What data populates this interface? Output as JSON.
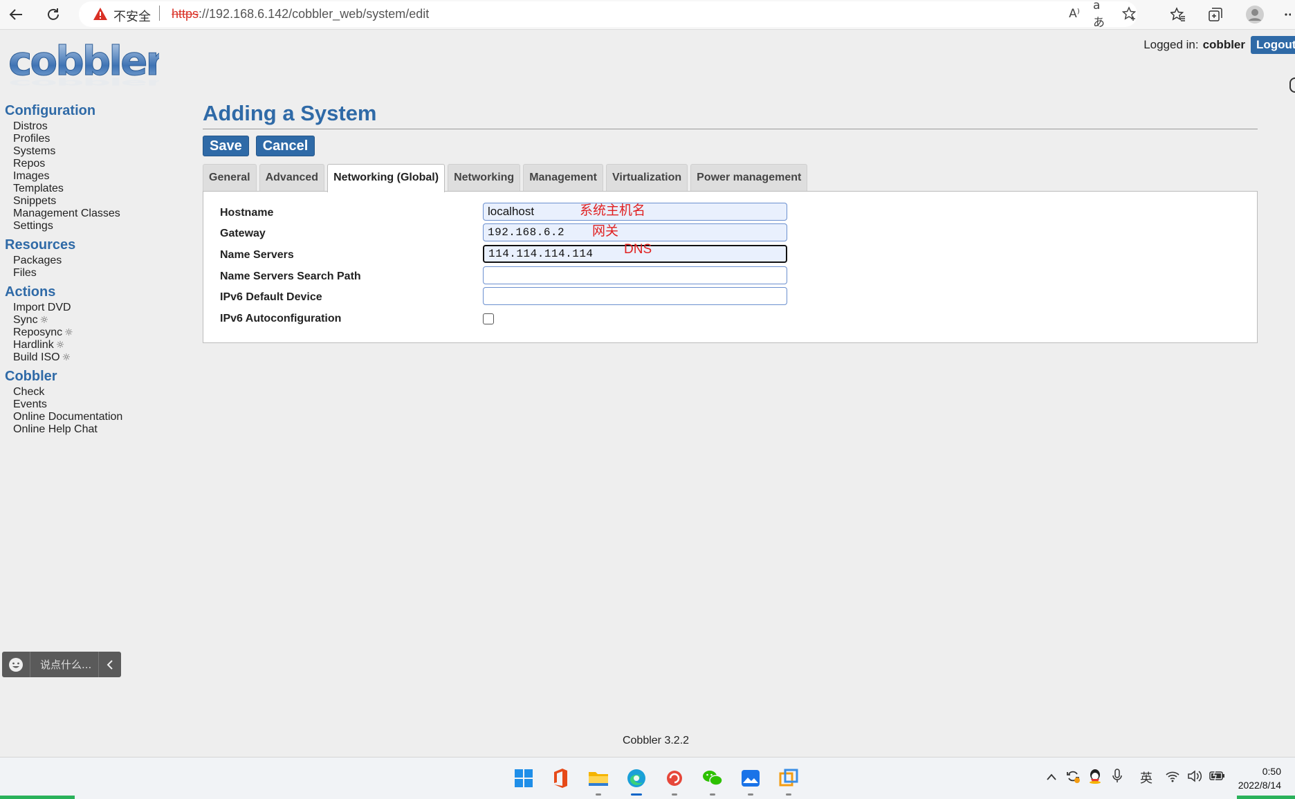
{
  "browser": {
    "security_label": "不安全",
    "url_scheme": "https",
    "url_rest": "://192.168.6.142/cobbler_web/system/edit",
    "read_aloud_icon": "A⁾",
    "translate_icon": "aあ"
  },
  "header": {
    "logo_alt": "cobbler",
    "login_label": "Logged in:",
    "login_user": "cobbler",
    "logout_label": "Logout"
  },
  "sidebar": {
    "sections": [
      {
        "title": "Configuration",
        "items": [
          "Distros",
          "Profiles",
          "Systems",
          "Repos",
          "Images",
          "Templates",
          "Snippets",
          "Management Classes",
          "Settings"
        ]
      },
      {
        "title": "Resources",
        "items": [
          "Packages",
          "Files"
        ]
      },
      {
        "title": "Actions",
        "items": [
          "Import DVD",
          "Sync",
          "Reposync",
          "Hardlink",
          "Build ISO"
        ]
      },
      {
        "title": "Cobbler",
        "items": [
          "Check",
          "Events",
          "Online Documentation",
          "Online Help Chat"
        ]
      }
    ]
  },
  "main": {
    "title": "Adding a System",
    "save_label": "Save",
    "cancel_label": "Cancel",
    "tabs": [
      "General",
      "Advanced",
      "Networking (Global)",
      "Networking",
      "Management",
      "Virtualization",
      "Power management"
    ],
    "active_tab": "Networking (Global)",
    "fields": {
      "hostname": {
        "label": "Hostname",
        "value": "localhost",
        "annotation": "系统主机名"
      },
      "gateway": {
        "label": "Gateway",
        "value": "192.168.6.2",
        "annotation": "网关"
      },
      "name_servers": {
        "label": "Name Servers",
        "value": "114.114.114.114",
        "annotation": "DNS"
      },
      "name_servers_search": {
        "label": "Name Servers Search Path",
        "value": ""
      },
      "ipv6_default_device": {
        "label": "IPv6 Default Device",
        "value": ""
      },
      "ipv6_autoconf": {
        "label": "IPv6 Autoconfiguration",
        "checked": false
      }
    }
  },
  "chat": {
    "placeholder": "说点什么..."
  },
  "footer": {
    "version": "Cobbler 3.2.2"
  },
  "taskbar": {
    "ime": "英",
    "time": "0:50",
    "date": "2022/8/14"
  },
  "colors": {
    "accent": "#2f6aa7",
    "annotation": "#e02020"
  }
}
